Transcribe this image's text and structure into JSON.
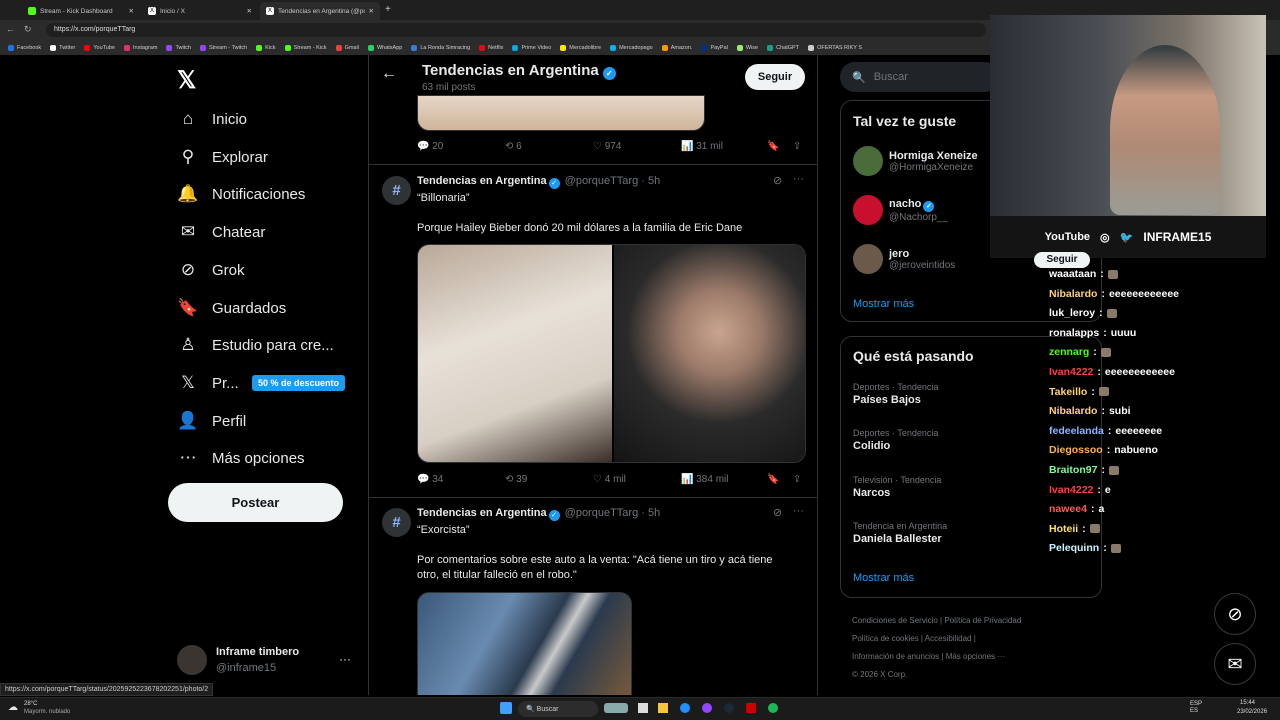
{
  "browser": {
    "tabs": [
      {
        "title": "Stream - Kick Dashboard",
        "color": "#53fc18"
      },
      {
        "title": "Inicio / X",
        "color": "#ffffff"
      },
      {
        "title": "Tendencias en Argentina (@porqu...",
        "color": "#ffffff"
      }
    ],
    "new_tab": "+",
    "url": "https://x.com/porqueTTarg",
    "bookmarks": [
      {
        "label": "Facebook",
        "color": "#1877f2"
      },
      {
        "label": "Twitter",
        "color": "#ffffff"
      },
      {
        "label": "YouTube",
        "color": "#ff0000"
      },
      {
        "label": "Instagram",
        "color": "#e1306c"
      },
      {
        "label": "Twitch",
        "color": "#9146ff"
      },
      {
        "label": "Stream - Twitch",
        "color": "#9146ff"
      },
      {
        "label": "Kick",
        "color": "#53fc18"
      },
      {
        "label": "Stream - Kick",
        "color": "#53fc18"
      },
      {
        "label": "Gmail",
        "color": "#ea4335"
      },
      {
        "label": "WhatsApp",
        "color": "#25d366"
      },
      {
        "label": "La Ronda Simracing",
        "color": "#3a7bd5"
      },
      {
        "label": "Netflix",
        "color": "#e50914"
      },
      {
        "label": "Prime Video",
        "color": "#00a8e1"
      },
      {
        "label": "Mercadolibre",
        "color": "#ffe600"
      },
      {
        "label": "Mercadopago",
        "color": "#00b1ea"
      },
      {
        "label": "Amazon.",
        "color": "#ff9900"
      },
      {
        "label": "PayPal",
        "color": "#003087"
      },
      {
        "label": "Wise",
        "color": "#9fe870"
      },
      {
        "label": "ChatGPT",
        "color": "#10a37f"
      },
      {
        "label": "OFERTAS RIKY S",
        "color": "#cccccc"
      }
    ],
    "status_url": "https://x.com/porqueTTarg/status/2025925223678202251/photo/2"
  },
  "nav": {
    "items": [
      {
        "label": "Inicio",
        "icon": "home-icon"
      },
      {
        "label": "Explorar",
        "icon": "search-icon"
      },
      {
        "label": "Notificaciones",
        "icon": "bell-icon"
      },
      {
        "label": "Chatear",
        "icon": "mail-icon"
      },
      {
        "label": "Grok",
        "icon": "grok-icon"
      },
      {
        "label": "Guardados",
        "icon": "bookmark-icon"
      },
      {
        "label": "Estudio para cre...",
        "icon": "creator-studio-icon"
      },
      {
        "label": "Pr...",
        "icon": "x-premium-icon"
      },
      {
        "label": "Perfil",
        "icon": "person-icon"
      },
      {
        "label": "Más opciones",
        "icon": "more-circle-icon"
      }
    ],
    "premium_badge": "50 % de descuento",
    "post_button": "Postear",
    "account": {
      "name": "Inframe timbero",
      "handle": "@inframe15",
      "more": "···"
    }
  },
  "header": {
    "title": "Tendencias en Argentina",
    "subtitle": "63 mil posts",
    "follow": "Seguir"
  },
  "tweets": [
    {
      "stats": {
        "replies": "20",
        "reposts": "6",
        "likes": "974",
        "views": "31 mil"
      }
    },
    {
      "name": "Tendencias en Argentina",
      "handle": "@porqueTTarg",
      "time": "· 5h",
      "quote": "“Billonaria”",
      "text": "Porque Hailey Bieber donó 20 mil dólares a la familia de Eric Dane",
      "stats": {
        "replies": "34",
        "reposts": "39",
        "likes": "4 mil",
        "views": "384 mil"
      }
    },
    {
      "name": "Tendencias en Argentina",
      "handle": "@porqueTTarg",
      "time": "· 5h",
      "quote": "“Exorcista”",
      "text": "Por comentarios sobre este auto a la venta: \"Acá tiene un tiro y acá tiene otro, el titular falleció en el robo.\""
    }
  ],
  "right": {
    "search_placeholder": "Buscar",
    "suggest_title": "Tal vez te guste",
    "suggestions": [
      {
        "name": "Hormiga Xeneize",
        "handle": "@HormigaXeneize",
        "avatar_color": "#4a6b3a",
        "verified": false
      },
      {
        "name": "nacho",
        "handle": "@Nachorp__",
        "avatar_color": "#c8102e",
        "verified": true
      },
      {
        "name": "jero",
        "handle": "@jeroveintidos",
        "avatar_color": "#6b5a4a",
        "verified": false
      }
    ],
    "show_more": "Mostrar más",
    "trends_title": "Qué está pasando",
    "trends": [
      {
        "category": "Deportes · Tendencia",
        "title": "Países Bajos"
      },
      {
        "category": "Deportes · Tendencia",
        "title": "Colidio"
      },
      {
        "category": "Televisión · Tendencia",
        "title": "Narcos"
      },
      {
        "category": "Tendencia en Argentina",
        "title": "Daniela Ballester"
      }
    ],
    "trends_show_more": "Mostrar más",
    "footer": [
      "Condiciones de Servicio  |  Política de Privacidad",
      "Política de cookies  |  Accesibilidad  |",
      "Información de anuncios  |  Más opciones ···",
      "© 2026 X Corp."
    ]
  },
  "overlay": {
    "socials": [
      "YouTube",
      "◎",
      "🐦",
      "INFRAME15"
    ],
    "chat_partial_top": "Seguir",
    "chat": [
      {
        "user": "waaataan",
        "msg": "",
        "color": "#ffffff",
        "emote": true
      },
      {
        "user": "Nibalardo",
        "msg": "eeeeeeeeeeee",
        "color": "#ffd27a",
        "emote": false
      },
      {
        "user": "luk_leroy",
        "msg": "",
        "color": "#ffffff",
        "emote": true
      },
      {
        "user": "ronalapps",
        "msg": "uuuu",
        "color": "#ffffff",
        "emote": false
      },
      {
        "user": "zennarg",
        "msg": "",
        "color": "#53fc18",
        "emote": true
      },
      {
        "user": "Ivan4222",
        "msg": "eeeeeeeeeeee",
        "color": "#ff4040",
        "emote": false
      },
      {
        "user": "Takeillo",
        "msg": "",
        "color": "#ffd27a",
        "emote": true
      },
      {
        "user": "Nibalardo",
        "msg": "subi",
        "color": "#ffd27a",
        "emote": false
      },
      {
        "user": "fedeelanda",
        "msg": "eeeeeeee",
        "color": "#8fb3ff",
        "emote": false
      },
      {
        "user": "Diegossoo",
        "msg": "nabueno",
        "color": "#ffb347",
        "emote": false
      },
      {
        "user": "Braiton97",
        "msg": "",
        "color": "#7cfc9a",
        "emote": true
      },
      {
        "user": "Ivan4222",
        "msg": "e",
        "color": "#ff4040",
        "emote": false
      },
      {
        "user": "nawee4",
        "msg": "a",
        "color": "#ff5a5a",
        "emote": false
      },
      {
        "user": "Hoteii",
        "msg": "",
        "color": "#ffe65a",
        "emote": true
      },
      {
        "user": "Pelequinn",
        "msg": "",
        "color": "#c8f5ff",
        "emote": true
      }
    ]
  },
  "taskbar": {
    "weather": "28°C",
    "weather_desc": "Mayorm. nublado",
    "search": "Buscar",
    "lang": "ESP\nES",
    "time": "15:44",
    "date": "23/02/2026"
  }
}
